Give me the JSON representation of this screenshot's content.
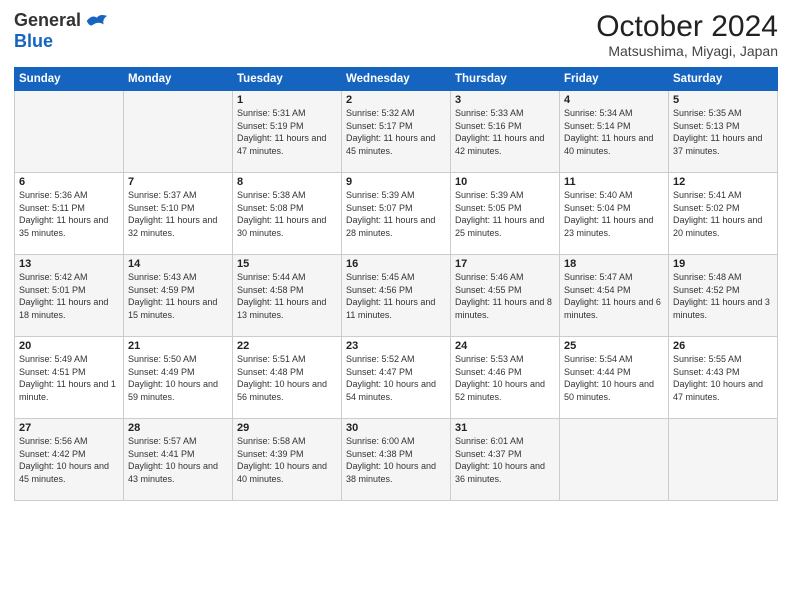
{
  "logo": {
    "general": "General",
    "blue": "Blue"
  },
  "title": "October 2024",
  "location": "Matsushima, Miyagi, Japan",
  "headers": [
    "Sunday",
    "Monday",
    "Tuesday",
    "Wednesday",
    "Thursday",
    "Friday",
    "Saturday"
  ],
  "weeks": [
    [
      {
        "day": "",
        "info": ""
      },
      {
        "day": "",
        "info": ""
      },
      {
        "day": "1",
        "info": "Sunrise: 5:31 AM\nSunset: 5:19 PM\nDaylight: 11 hours and 47 minutes."
      },
      {
        "day": "2",
        "info": "Sunrise: 5:32 AM\nSunset: 5:17 PM\nDaylight: 11 hours and 45 minutes."
      },
      {
        "day": "3",
        "info": "Sunrise: 5:33 AM\nSunset: 5:16 PM\nDaylight: 11 hours and 42 minutes."
      },
      {
        "day": "4",
        "info": "Sunrise: 5:34 AM\nSunset: 5:14 PM\nDaylight: 11 hours and 40 minutes."
      },
      {
        "day": "5",
        "info": "Sunrise: 5:35 AM\nSunset: 5:13 PM\nDaylight: 11 hours and 37 minutes."
      }
    ],
    [
      {
        "day": "6",
        "info": "Sunrise: 5:36 AM\nSunset: 5:11 PM\nDaylight: 11 hours and 35 minutes."
      },
      {
        "day": "7",
        "info": "Sunrise: 5:37 AM\nSunset: 5:10 PM\nDaylight: 11 hours and 32 minutes."
      },
      {
        "day": "8",
        "info": "Sunrise: 5:38 AM\nSunset: 5:08 PM\nDaylight: 11 hours and 30 minutes."
      },
      {
        "day": "9",
        "info": "Sunrise: 5:39 AM\nSunset: 5:07 PM\nDaylight: 11 hours and 28 minutes."
      },
      {
        "day": "10",
        "info": "Sunrise: 5:39 AM\nSunset: 5:05 PM\nDaylight: 11 hours and 25 minutes."
      },
      {
        "day": "11",
        "info": "Sunrise: 5:40 AM\nSunset: 5:04 PM\nDaylight: 11 hours and 23 minutes."
      },
      {
        "day": "12",
        "info": "Sunrise: 5:41 AM\nSunset: 5:02 PM\nDaylight: 11 hours and 20 minutes."
      }
    ],
    [
      {
        "day": "13",
        "info": "Sunrise: 5:42 AM\nSunset: 5:01 PM\nDaylight: 11 hours and 18 minutes."
      },
      {
        "day": "14",
        "info": "Sunrise: 5:43 AM\nSunset: 4:59 PM\nDaylight: 11 hours and 15 minutes."
      },
      {
        "day": "15",
        "info": "Sunrise: 5:44 AM\nSunset: 4:58 PM\nDaylight: 11 hours and 13 minutes."
      },
      {
        "day": "16",
        "info": "Sunrise: 5:45 AM\nSunset: 4:56 PM\nDaylight: 11 hours and 11 minutes."
      },
      {
        "day": "17",
        "info": "Sunrise: 5:46 AM\nSunset: 4:55 PM\nDaylight: 11 hours and 8 minutes."
      },
      {
        "day": "18",
        "info": "Sunrise: 5:47 AM\nSunset: 4:54 PM\nDaylight: 11 hours and 6 minutes."
      },
      {
        "day": "19",
        "info": "Sunrise: 5:48 AM\nSunset: 4:52 PM\nDaylight: 11 hours and 3 minutes."
      }
    ],
    [
      {
        "day": "20",
        "info": "Sunrise: 5:49 AM\nSunset: 4:51 PM\nDaylight: 11 hours and 1 minute."
      },
      {
        "day": "21",
        "info": "Sunrise: 5:50 AM\nSunset: 4:49 PM\nDaylight: 10 hours and 59 minutes."
      },
      {
        "day": "22",
        "info": "Sunrise: 5:51 AM\nSunset: 4:48 PM\nDaylight: 10 hours and 56 minutes."
      },
      {
        "day": "23",
        "info": "Sunrise: 5:52 AM\nSunset: 4:47 PM\nDaylight: 10 hours and 54 minutes."
      },
      {
        "day": "24",
        "info": "Sunrise: 5:53 AM\nSunset: 4:46 PM\nDaylight: 10 hours and 52 minutes."
      },
      {
        "day": "25",
        "info": "Sunrise: 5:54 AM\nSunset: 4:44 PM\nDaylight: 10 hours and 50 minutes."
      },
      {
        "day": "26",
        "info": "Sunrise: 5:55 AM\nSunset: 4:43 PM\nDaylight: 10 hours and 47 minutes."
      }
    ],
    [
      {
        "day": "27",
        "info": "Sunrise: 5:56 AM\nSunset: 4:42 PM\nDaylight: 10 hours and 45 minutes."
      },
      {
        "day": "28",
        "info": "Sunrise: 5:57 AM\nSunset: 4:41 PM\nDaylight: 10 hours and 43 minutes."
      },
      {
        "day": "29",
        "info": "Sunrise: 5:58 AM\nSunset: 4:39 PM\nDaylight: 10 hours and 40 minutes."
      },
      {
        "day": "30",
        "info": "Sunrise: 6:00 AM\nSunset: 4:38 PM\nDaylight: 10 hours and 38 minutes."
      },
      {
        "day": "31",
        "info": "Sunrise: 6:01 AM\nSunset: 4:37 PM\nDaylight: 10 hours and 36 minutes."
      },
      {
        "day": "",
        "info": ""
      },
      {
        "day": "",
        "info": ""
      }
    ]
  ]
}
